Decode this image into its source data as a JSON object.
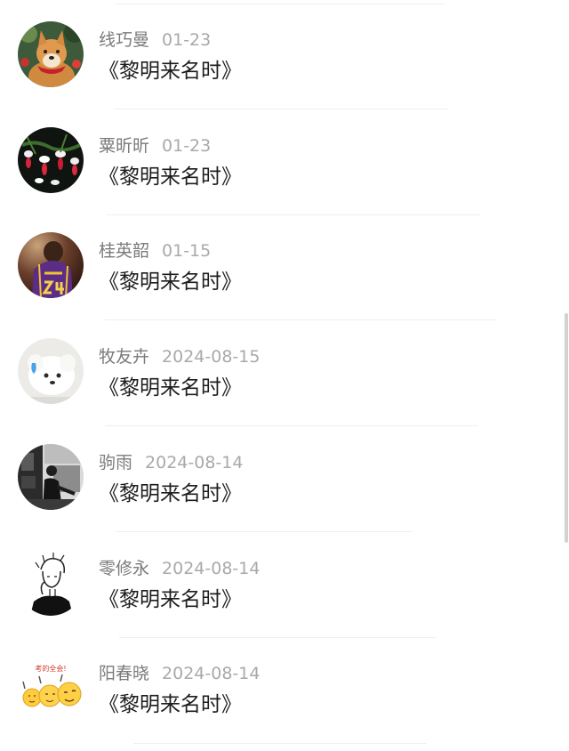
{
  "comments": [
    {
      "name": "线巧曼",
      "date": "01-23",
      "text": "《黎明来名时》",
      "avatar": "shiba-dog-avatar"
    },
    {
      "name": "粟昕昕",
      "date": "01-23",
      "text": "《黎明来名时》",
      "avatar": "fuchsia-flowers-avatar"
    },
    {
      "name": "桂英韶",
      "date": "01-15",
      "text": "《黎明来名时》",
      "avatar": "basketball-jersey-avatar"
    },
    {
      "name": "牧友卉",
      "date": "2024-08-15",
      "text": "《黎明来名时》",
      "avatar": "white-puppy-avatar"
    },
    {
      "name": "驹雨",
      "date": "2024-08-14",
      "text": "《黎明来名时》",
      "avatar": "bw-street-photo-avatar"
    },
    {
      "name": "零修永",
      "date": "2024-08-14",
      "text": "《黎明来名时》",
      "avatar": "line-art-figure-avatar"
    },
    {
      "name": "阳春晓",
      "date": "2024-08-14",
      "text": "《黎明来名时》",
      "avatar": "emoji-sticker-avatar"
    }
  ],
  "sticker_text": "考的全会!"
}
